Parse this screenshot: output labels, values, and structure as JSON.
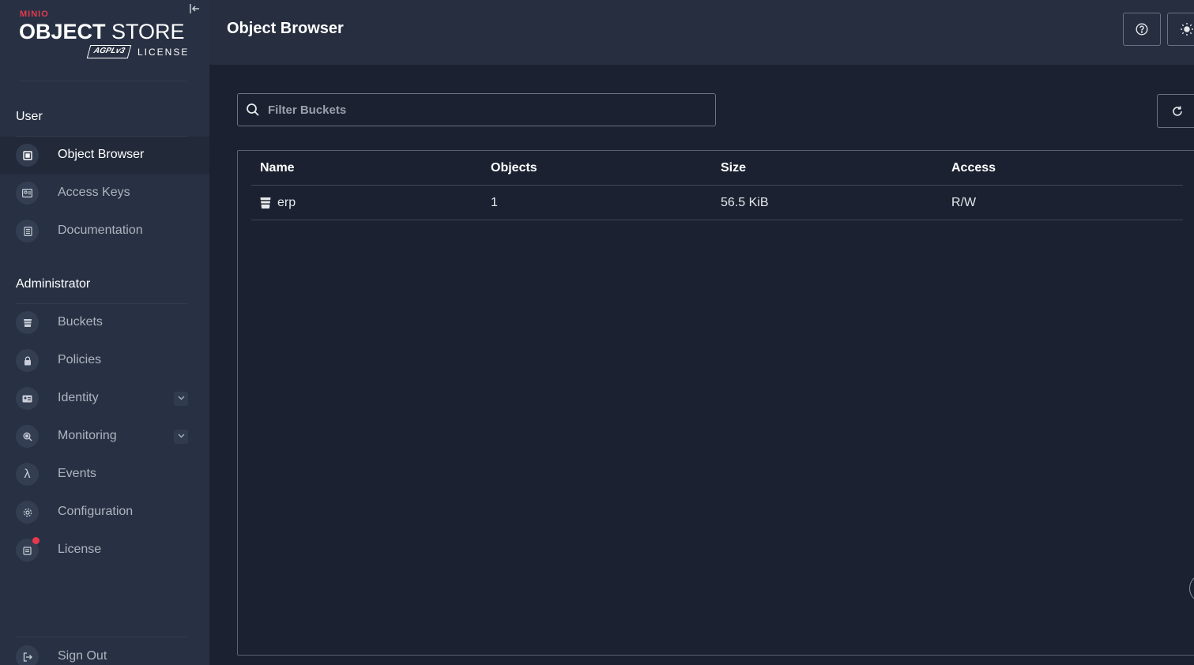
{
  "brand": {
    "minio": "MINIO",
    "object": "OBJECT",
    "store": "STORE",
    "agpl": "AGPLv3",
    "license": "LICENSE"
  },
  "sidebar": {
    "user_section": "User",
    "admin_section": "Administrator",
    "user_items": [
      {
        "label": "Object Browser",
        "icon": "object-browser-icon",
        "active": true
      },
      {
        "label": "Access Keys",
        "icon": "access-keys-icon"
      },
      {
        "label": "Documentation",
        "icon": "documentation-icon"
      }
    ],
    "admin_items": [
      {
        "label": "Buckets",
        "icon": "bucket-icon"
      },
      {
        "label": "Policies",
        "icon": "lock-icon"
      },
      {
        "label": "Identity",
        "icon": "identity-icon",
        "expandable": true
      },
      {
        "label": "Monitoring",
        "icon": "monitoring-icon",
        "expandable": true
      },
      {
        "label": "Events",
        "icon": "lambda-icon"
      },
      {
        "label": "Configuration",
        "icon": "gear-icon"
      },
      {
        "label": "License",
        "icon": "license-icon",
        "badge": true
      }
    ],
    "sign_out": "Sign Out"
  },
  "header": {
    "title": "Object Browser"
  },
  "search": {
    "placeholder": "Filter Buckets",
    "value": ""
  },
  "table": {
    "columns": [
      "Name",
      "Objects",
      "Size",
      "Access"
    ],
    "rows": [
      {
        "name": "erp",
        "objects": "1",
        "size": "56.5 KiB",
        "access": "R/W"
      }
    ]
  },
  "colors": {
    "sidebar_bg": "#283143",
    "header_bg": "#262e3f",
    "main_bg": "#1b2130",
    "brand_red": "#e23a4d",
    "badge_red": "#e8384f"
  }
}
